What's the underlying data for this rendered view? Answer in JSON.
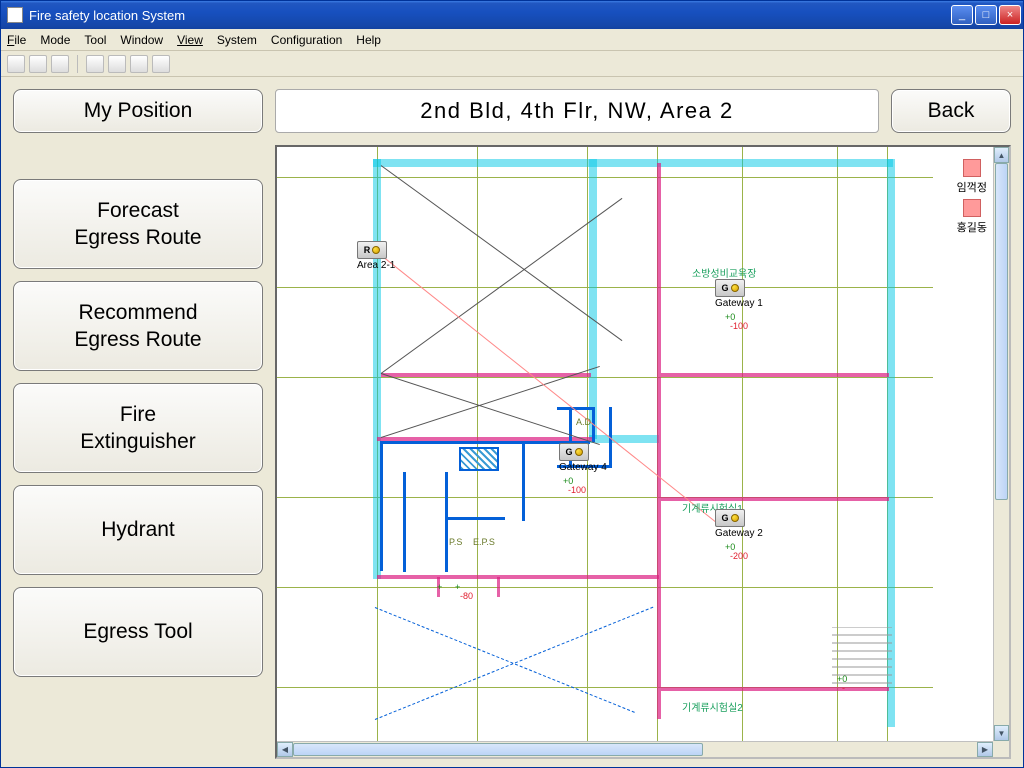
{
  "window": {
    "title": "Fire safety location System"
  },
  "menubar": {
    "file": "File",
    "mode": "Mode",
    "tool": "Tool",
    "window": "Window",
    "view": "View",
    "system": "System",
    "configuration": "Configuration",
    "help": "Help"
  },
  "buttons": {
    "my_position": "My Position",
    "forecast": "Forecast\nEgress Route",
    "recommend": "Recommend\nEgress Route",
    "extinguisher": "Fire\nExtinguisher",
    "hydrant": "Hydrant",
    "egress_tool": "Egress Tool",
    "back": "Back"
  },
  "location_bar": "2nd Bld, 4th Flr, NW, Area 2",
  "plan": {
    "rooms": {
      "r1": "소방성비교육장",
      "r2": "기계류시험실1",
      "r3": "기계류시험실2",
      "ad": "A.D",
      "ps": "P.S",
      "eps": "E.P.S"
    },
    "nodes": {
      "area21": {
        "tag": "R",
        "label": "Area 2-1"
      },
      "gw1": {
        "tag": "G",
        "label": "Gateway 1"
      },
      "gw4": {
        "tag": "G",
        "label": "Gateway 4"
      },
      "gw2": {
        "tag": "G",
        "label": "Gateway 2"
      }
    },
    "coords": {
      "gw1": "+0\n  -100",
      "gw4": "+0\n  -100",
      "gw2": "+0\n  -200",
      "hall": "+\n  -80",
      "rear": "+0\n  -"
    },
    "legend": {
      "a": "임꺽정",
      "b": "홍길동"
    }
  }
}
